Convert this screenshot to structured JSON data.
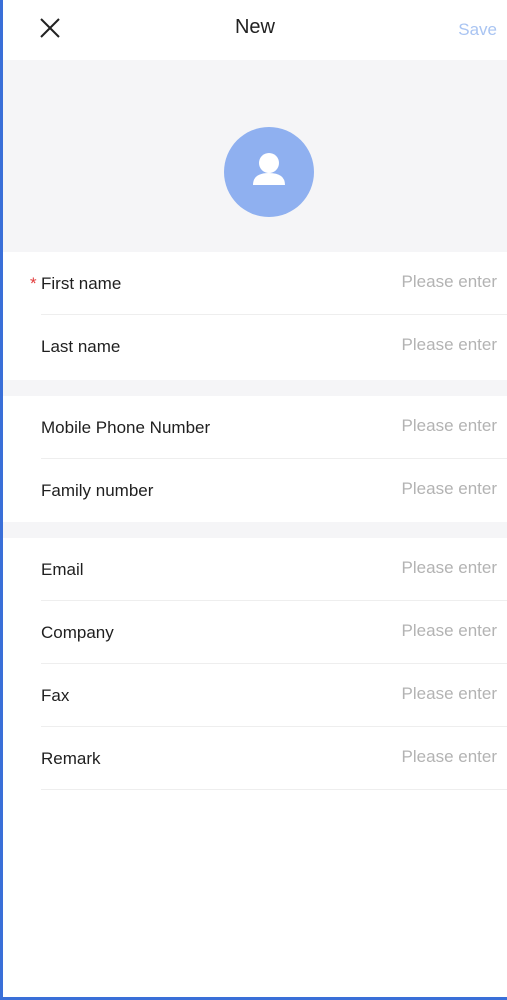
{
  "header": {
    "title": "New",
    "save_label": "Save",
    "close_icon": "close-icon"
  },
  "avatar": {
    "icon": "person-icon",
    "color": "#8fb0f0"
  },
  "colors": {
    "accent_disabled": "#a9c4f2",
    "required": "#e23b3b",
    "section_bg": "#f5f5f7",
    "frame": "#3a6fd8"
  },
  "form": {
    "required_marker": "*",
    "placeholder": "Please enter",
    "fields": [
      {
        "label": "First name",
        "value": "",
        "required": true
      },
      {
        "label": "Last name",
        "value": ""
      },
      {
        "label": "Mobile Phone Number",
        "value": ""
      },
      {
        "label": "Family number",
        "value": ""
      },
      {
        "label": "Email",
        "value": ""
      },
      {
        "label": "Company",
        "value": ""
      },
      {
        "label": "Fax",
        "value": ""
      },
      {
        "label": "Remark",
        "value": ""
      }
    ]
  }
}
